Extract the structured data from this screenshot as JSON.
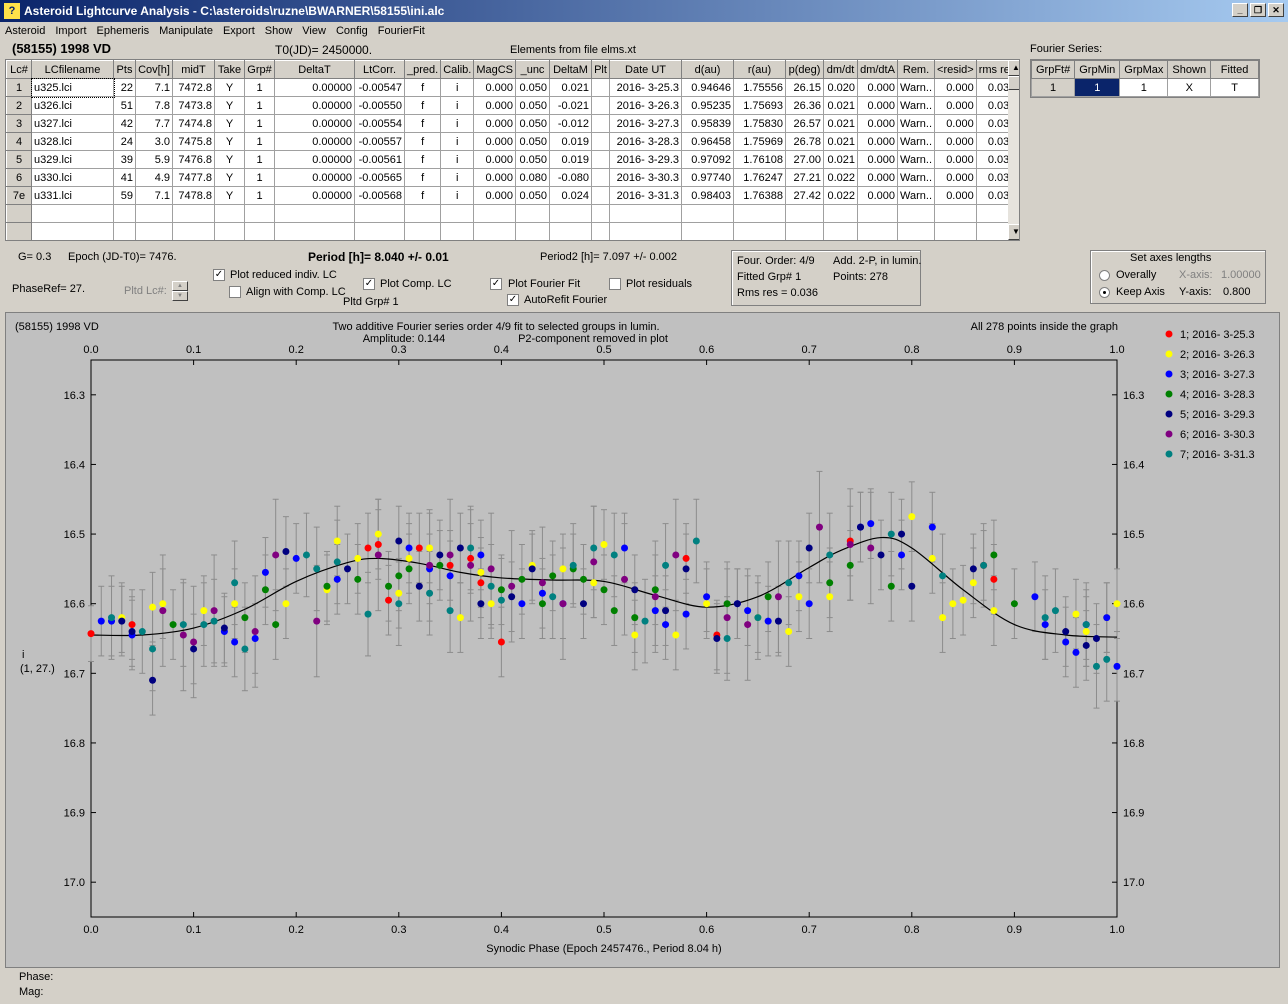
{
  "window": {
    "title": "Asteroid Lightcurve Analysis - C:\\asteroids\\ruzne\\BWARNER\\58155\\ini.alc",
    "icon": "app-icon"
  },
  "menu": [
    "Asteroid",
    "Import",
    "Ephemeris",
    "Manipulate",
    "Export",
    "Show",
    "View",
    "Config",
    "FourierFit"
  ],
  "header": {
    "asteroid": "(58155) 1998 VD",
    "t0": "T0(JD)= 2450000.",
    "elements": "Elements from file elms.xt",
    "fourier_label": "Fourier Series:"
  },
  "table": {
    "columns": [
      "Lc#",
      "LCfilename",
      "Pts",
      "Cov[h]",
      "midT",
      "Take",
      "Grp#",
      "DeltaT",
      "LtCorr.",
      "_pred.",
      "Calib.",
      "MagCS",
      "_unc",
      "DeltaM",
      "Plt",
      "Date UT",
      "d(au)",
      "r(au)",
      "p(deg)",
      "dm/dt",
      "dm/dtA",
      "Rem.",
      "<resid>",
      "rms res"
    ],
    "rows": [
      [
        "1",
        "u325.lci",
        "22",
        "7.1",
        "7472.8",
        "Y",
        "1",
        "0.00000",
        "-0.00547",
        "f",
        "i",
        "0.000",
        "0.050",
        "0.021",
        "",
        "2016- 3-25.3",
        "0.94646",
        "1.75556",
        "26.15",
        "0.020",
        "0.000",
        "Warn..",
        "0.000",
        "0.035"
      ],
      [
        "2",
        "u326.lci",
        "51",
        "7.8",
        "7473.8",
        "Y",
        "1",
        "0.00000",
        "-0.00550",
        "f",
        "i",
        "0.000",
        "0.050",
        "-0.021",
        "",
        "2016- 3-26.3",
        "0.95235",
        "1.75693",
        "26.36",
        "0.021",
        "0.000",
        "Warn..",
        "0.000",
        "0.033"
      ],
      [
        "3",
        "u327.lci",
        "42",
        "7.7",
        "7474.8",
        "Y",
        "1",
        "0.00000",
        "-0.00554",
        "f",
        "i",
        "0.000",
        "0.050",
        "-0.012",
        "",
        "2016- 3-27.3",
        "0.95839",
        "1.75830",
        "26.57",
        "0.021",
        "0.000",
        "Warn..",
        "0.000",
        "0.031"
      ],
      [
        "4",
        "u328.lci",
        "24",
        "3.0",
        "7475.8",
        "Y",
        "1",
        "0.00000",
        "-0.00557",
        "f",
        "i",
        "0.000",
        "0.050",
        "0.019",
        "",
        "2016- 3-28.3",
        "0.96458",
        "1.75969",
        "26.78",
        "0.021",
        "0.000",
        "Warn..",
        "0.000",
        "0.030"
      ],
      [
        "5",
        "u329.lci",
        "39",
        "5.9",
        "7476.8",
        "Y",
        "1",
        "0.00000",
        "-0.00561",
        "f",
        "i",
        "0.000",
        "0.050",
        "0.019",
        "",
        "2016- 3-29.3",
        "0.97092",
        "1.76108",
        "27.00",
        "0.021",
        "0.000",
        "Warn..",
        "0.000",
        "0.033"
      ],
      [
        "6",
        "u330.lci",
        "41",
        "4.9",
        "7477.8",
        "Y",
        "1",
        "0.00000",
        "-0.00565",
        "f",
        "i",
        "0.000",
        "0.080",
        "-0.080",
        "",
        "2016- 3-30.3",
        "0.97740",
        "1.76247",
        "27.21",
        "0.022",
        "0.000",
        "Warn..",
        "0.000",
        "0.036"
      ],
      [
        "7e",
        "u331.lci",
        "59",
        "7.1",
        "7478.8",
        "Y",
        "1",
        "0.00000",
        "-0.00568",
        "f",
        "i",
        "0.000",
        "0.050",
        "0.024",
        "",
        "2016- 3-31.3",
        "0.98403",
        "1.76388",
        "27.42",
        "0.022",
        "0.000",
        "Warn..",
        "0.000",
        "0.035"
      ]
    ]
  },
  "fourier_table": {
    "columns": [
      "GrpFt#",
      "GrpMin",
      "GrpMax",
      "Shown",
      "Fitted"
    ],
    "row": [
      "1",
      "1",
      "1",
      "X",
      "T"
    ]
  },
  "controls": {
    "g": "G= 0.3",
    "epoch": "Epoch (JD-T0)= 7476.",
    "period": "Period [h]= 8.040 +/- 0.01",
    "period2": "Period2 [h]= 7.097 +/- 0.002",
    "phase_ref": "PhaseRef= 27.",
    "plotted_lc": "Pltd Lc#:",
    "plotted_grp": "Pltd Grp#  1",
    "plot_reduced": "Plot reduced indiv. LC",
    "align_comp": "Align with Comp. LC",
    "plot_comp": "Plot Comp. LC",
    "plot_fourier": "Plot Fourier Fit",
    "autorefit": "AutoRefit Fourier",
    "plot_residuals": "Plot residuals",
    "plot_reduced_checked": true,
    "align_comp_checked": false,
    "plot_comp_checked": true,
    "plot_fourier_checked": true,
    "autorefit_checked": true,
    "plot_residuals_checked": false
  },
  "fit_info": {
    "order": "Four. Order:  4/9",
    "add": "Add. 2-P, in lumin.",
    "fitted": "Fitted Grp# 1",
    "points": "Points: 278",
    "rms": "Rms res     = 0.036"
  },
  "axes_box": {
    "title": "Set axes lengths",
    "overally": "Overally",
    "keep_axis": "Keep Axis",
    "xaxis_label": "X-axis:",
    "xaxis_value": "1.00000",
    "yaxis_label": "Y-axis:",
    "yaxis_value": "0.800",
    "selected": "keep_axis"
  },
  "plot": {
    "asteroid": "(58155) 1998 VD",
    "desc1": "Two additive Fourier series order 4/9 fit to selected groups in lumin.",
    "amplitude": "Amplitude: 0.144",
    "p2": "P2-component removed in plot",
    "inside": "All 278 points inside the graph",
    "ylabel1": "i",
    "ylabel2": "(1, 27.)",
    "xlabel": "Synodic Phase (Epoch 2457476., Period 8.04 h)"
  },
  "status": {
    "phase": "Phase:",
    "mag": "Mag:"
  },
  "chart_data": {
    "type": "scatter",
    "xlabel": "Synodic Phase (Epoch 2457476., Period 8.04 h)",
    "ylabel": "i (1, 27.)",
    "xlim": [
      0.0,
      1.0
    ],
    "ylim": [
      16.25,
      17.05
    ],
    "y_inverted": true,
    "xticks": [
      "0.0",
      "0.1",
      "0.2",
      "0.3",
      "0.4",
      "0.5",
      "0.6",
      "0.7",
      "0.8",
      "0.9",
      "1.0"
    ],
    "yticks": [
      "16.3",
      "16.4",
      "16.5",
      "16.6",
      "16.7",
      "16.8",
      "16.9",
      "17.0"
    ],
    "legend_position": "right",
    "fourier_fit": {
      "phase": [
        0.0,
        0.05,
        0.1,
        0.15,
        0.2,
        0.25,
        0.28,
        0.32,
        0.36,
        0.4,
        0.45,
        0.5,
        0.55,
        0.6,
        0.65,
        0.7,
        0.73,
        0.77,
        0.8,
        0.85,
        0.9,
        0.95,
        1.0
      ],
      "mag": [
        16.645,
        16.645,
        16.635,
        16.608,
        16.568,
        16.541,
        16.535,
        16.542,
        16.555,
        16.563,
        16.566,
        16.568,
        16.588,
        16.605,
        16.59,
        16.548,
        16.524,
        16.505,
        16.52,
        16.58,
        16.63,
        16.645,
        16.648
      ]
    },
    "series": [
      {
        "name": "1; 2016- 3-25.3",
        "color": "#ff0000",
        "x": [
          0.0,
          0.04,
          0.27,
          0.28,
          0.29,
          0.32,
          0.35,
          0.37,
          0.38,
          0.4,
          0.58,
          0.61,
          0.74,
          0.87,
          0.88
        ],
        "y": [
          16.643,
          16.63,
          16.52,
          16.515,
          16.595,
          16.52,
          16.545,
          16.535,
          16.57,
          16.655,
          16.535,
          16.645,
          16.51,
          16.545,
          16.565
        ],
        "err": [
          0.04,
          0.05,
          0.05,
          0.05,
          0.05,
          0.05,
          0.05,
          0.05,
          0.05,
          0.05,
          0.05,
          0.05,
          0.05,
          0.05,
          0.05
        ]
      },
      {
        "name": "2; 2016- 3-26.3",
        "color": "#ffff00",
        "x": [
          0.03,
          0.06,
          0.07,
          0.11,
          0.14,
          0.19,
          0.23,
          0.24,
          0.26,
          0.28,
          0.3,
          0.31,
          0.33,
          0.36,
          0.38,
          0.39,
          0.43,
          0.46,
          0.49,
          0.5,
          0.53,
          0.57,
          0.6,
          0.65,
          0.68,
          0.69,
          0.72,
          0.8,
          0.82,
          0.83,
          0.84,
          0.85,
          0.86,
          0.88,
          0.96,
          0.97,
          0.99,
          1.0
        ],
        "y": [
          16.62,
          16.605,
          16.6,
          16.61,
          16.6,
          16.6,
          16.58,
          16.51,
          16.535,
          16.5,
          16.585,
          16.535,
          16.52,
          16.62,
          16.555,
          16.6,
          16.545,
          16.55,
          16.57,
          16.515,
          16.645,
          16.645,
          16.6,
          16.62,
          16.64,
          16.59,
          16.59,
          16.475,
          16.535,
          16.62,
          16.6,
          16.595,
          16.57,
          16.61,
          16.615,
          16.64,
          16.62,
          16.6
        ],
        "err": [
          0.05,
          0.05,
          0.05,
          0.05,
          0.05,
          0.05,
          0.05,
          0.05,
          0.05,
          0.05,
          0.05,
          0.05,
          0.05,
          0.05,
          0.05,
          0.05,
          0.05,
          0.05,
          0.05,
          0.05,
          0.05,
          0.05,
          0.05,
          0.05,
          0.05,
          0.05,
          0.05,
          0.05,
          0.05,
          0.05,
          0.05,
          0.05,
          0.05,
          0.05,
          0.05,
          0.05,
          0.05,
          0.05
        ]
      },
      {
        "name": "3; 2016- 3-27.3",
        "color": "#0000ff",
        "x": [
          0.01,
          0.02,
          0.04,
          0.13,
          0.14,
          0.16,
          0.17,
          0.2,
          0.24,
          0.31,
          0.33,
          0.35,
          0.38,
          0.42,
          0.44,
          0.46,
          0.52,
          0.55,
          0.56,
          0.58,
          0.6,
          0.63,
          0.64,
          0.66,
          0.69,
          0.7,
          0.75,
          0.76,
          0.79,
          0.82,
          0.92,
          0.93,
          0.95,
          0.96,
          0.97,
          0.99,
          1.0
        ],
        "y": [
          16.625,
          16.625,
          16.645,
          16.64,
          16.655,
          16.65,
          16.555,
          16.535,
          16.565,
          16.52,
          16.55,
          16.56,
          16.53,
          16.6,
          16.585,
          16.6,
          16.52,
          16.61,
          16.63,
          16.615,
          16.59,
          16.6,
          16.61,
          16.625,
          16.56,
          16.6,
          16.49,
          16.485,
          16.53,
          16.49,
          16.59,
          16.63,
          16.655,
          16.67,
          16.63,
          16.62,
          16.69
        ],
        "err": [
          0.05,
          0.05,
          0.05,
          0.05,
          0.05,
          0.05,
          0.05,
          0.05,
          0.05,
          0.05,
          0.05,
          0.05,
          0.05,
          0.05,
          0.05,
          0.05,
          0.05,
          0.05,
          0.05,
          0.05,
          0.05,
          0.05,
          0.05,
          0.05,
          0.05,
          0.05,
          0.05,
          0.05,
          0.05,
          0.05,
          0.05,
          0.05,
          0.05,
          0.05,
          0.05,
          0.05,
          0.05
        ]
      },
      {
        "name": "4; 2016- 3-28.3",
        "color": "#008000",
        "x": [
          0.08,
          0.15,
          0.17,
          0.18,
          0.23,
          0.26,
          0.29,
          0.3,
          0.31,
          0.34,
          0.4,
          0.42,
          0.44,
          0.45,
          0.47,
          0.48,
          0.5,
          0.51,
          0.53,
          0.55,
          0.62,
          0.66,
          0.72,
          0.74,
          0.78,
          0.88,
          0.9
        ],
        "y": [
          16.63,
          16.62,
          16.58,
          16.63,
          16.575,
          16.565,
          16.575,
          16.56,
          16.55,
          16.545,
          16.58,
          16.565,
          16.6,
          16.56,
          16.55,
          16.565,
          16.58,
          16.61,
          16.62,
          16.58,
          16.6,
          16.59,
          16.57,
          16.545,
          16.575,
          16.53,
          16.6
        ],
        "err": [
          0.05,
          0.05,
          0.05,
          0.05,
          0.05,
          0.05,
          0.05,
          0.05,
          0.05,
          0.05,
          0.05,
          0.05,
          0.05,
          0.05,
          0.05,
          0.05,
          0.05,
          0.05,
          0.05,
          0.05,
          0.05,
          0.05,
          0.05,
          0.05,
          0.05,
          0.05,
          0.05
        ]
      },
      {
        "name": "5; 2016- 3-29.3",
        "color": "#000080",
        "x": [
          0.03,
          0.04,
          0.06,
          0.1,
          0.13,
          0.19,
          0.25,
          0.3,
          0.32,
          0.34,
          0.36,
          0.38,
          0.41,
          0.43,
          0.48,
          0.53,
          0.56,
          0.58,
          0.61,
          0.63,
          0.67,
          0.7,
          0.75,
          0.77,
          0.79,
          0.8,
          0.86,
          0.95,
          0.97,
          0.98
        ],
        "y": [
          16.625,
          16.64,
          16.71,
          16.665,
          16.635,
          16.525,
          16.55,
          16.51,
          16.575,
          16.53,
          16.52,
          16.6,
          16.59,
          16.55,
          16.6,
          16.58,
          16.61,
          16.55,
          16.65,
          16.6,
          16.625,
          16.52,
          16.49,
          16.53,
          16.5,
          16.575,
          16.55,
          16.64,
          16.66,
          16.65
        ],
        "err": [
          0.05,
          0.05,
          0.05,
          0.05,
          0.05,
          0.05,
          0.05,
          0.05,
          0.05,
          0.05,
          0.05,
          0.05,
          0.05,
          0.05,
          0.05,
          0.05,
          0.05,
          0.05,
          0.05,
          0.05,
          0.05,
          0.05,
          0.05,
          0.05,
          0.05,
          0.05,
          0.05,
          0.05,
          0.05,
          0.05
        ]
      },
      {
        "name": "6; 2016- 3-30.3",
        "color": "#800080",
        "x": [
          0.07,
          0.09,
          0.1,
          0.12,
          0.16,
          0.18,
          0.22,
          0.28,
          0.33,
          0.35,
          0.37,
          0.39,
          0.41,
          0.44,
          0.46,
          0.49,
          0.52,
          0.55,
          0.57,
          0.62,
          0.64,
          0.67,
          0.71,
          0.74,
          0.76
        ],
        "y": [
          16.61,
          16.645,
          16.655,
          16.61,
          16.64,
          16.53,
          16.625,
          16.53,
          16.545,
          16.53,
          16.545,
          16.55,
          16.575,
          16.57,
          16.6,
          16.54,
          16.565,
          16.59,
          16.53,
          16.62,
          16.63,
          16.59,
          16.49,
          16.515,
          16.52
        ],
        "err": [
          0.08,
          0.08,
          0.08,
          0.08,
          0.08,
          0.08,
          0.08,
          0.08,
          0.08,
          0.08,
          0.08,
          0.08,
          0.08,
          0.08,
          0.08,
          0.08,
          0.08,
          0.08,
          0.08,
          0.08,
          0.08,
          0.08,
          0.08,
          0.08,
          0.08
        ]
      },
      {
        "name": "7; 2016- 3-31.3",
        "color": "#008080",
        "x": [
          0.02,
          0.05,
          0.06,
          0.09,
          0.11,
          0.12,
          0.14,
          0.15,
          0.21,
          0.22,
          0.24,
          0.27,
          0.3,
          0.33,
          0.35,
          0.37,
          0.39,
          0.4,
          0.45,
          0.47,
          0.49,
          0.51,
          0.54,
          0.56,
          0.59,
          0.62,
          0.65,
          0.68,
          0.72,
          0.78,
          0.83,
          0.87,
          0.93,
          0.94,
          0.97,
          0.98,
          0.99
        ],
        "y": [
          16.62,
          16.64,
          16.665,
          16.63,
          16.63,
          16.625,
          16.57,
          16.665,
          16.53,
          16.55,
          16.54,
          16.615,
          16.6,
          16.585,
          16.61,
          16.52,
          16.575,
          16.595,
          16.59,
          16.545,
          16.52,
          16.53,
          16.625,
          16.545,
          16.51,
          16.65,
          16.62,
          16.57,
          16.53,
          16.5,
          16.56,
          16.545,
          16.62,
          16.61,
          16.63,
          16.69,
          16.68
        ],
        "err": [
          0.06,
          0.06,
          0.06,
          0.06,
          0.06,
          0.06,
          0.06,
          0.06,
          0.06,
          0.06,
          0.06,
          0.06,
          0.06,
          0.06,
          0.06,
          0.06,
          0.06,
          0.06,
          0.06,
          0.06,
          0.06,
          0.06,
          0.06,
          0.06,
          0.06,
          0.06,
          0.06,
          0.06,
          0.06,
          0.06,
          0.06,
          0.06,
          0.06,
          0.06,
          0.06,
          0.06,
          0.06
        ]
      }
    ]
  }
}
